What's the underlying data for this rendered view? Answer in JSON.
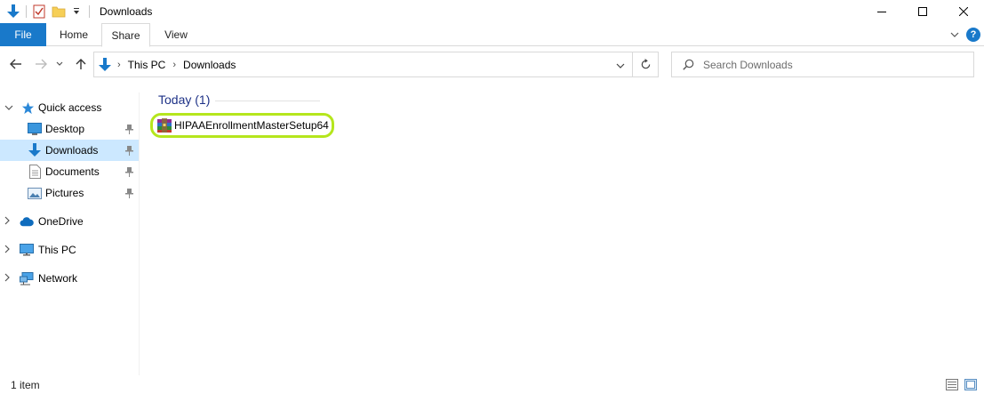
{
  "window": {
    "title": "Downloads",
    "controls": [
      "minimize",
      "maximize",
      "close"
    ]
  },
  "ribbon": {
    "tabs": [
      {
        "label": "File"
      },
      {
        "label": "Home"
      },
      {
        "label": "Share"
      },
      {
        "label": "View"
      }
    ],
    "help_label": "?"
  },
  "address": {
    "breadcrumbs": [
      "This PC",
      "Downloads"
    ],
    "separator": "›"
  },
  "search": {
    "placeholder": "Search Downloads"
  },
  "nav_pane": {
    "items": [
      {
        "label": "Quick access",
        "icon": "star-icon",
        "expander": "expanded"
      },
      {
        "label": "Desktop",
        "icon": "desktop-icon",
        "pinned": true
      },
      {
        "label": "Downloads",
        "icon": "download-arrow-icon",
        "pinned": true,
        "selected": true
      },
      {
        "label": "Documents",
        "icon": "document-icon",
        "pinned": true
      },
      {
        "label": "Pictures",
        "icon": "pictures-icon",
        "pinned": true
      },
      {
        "label": "OneDrive",
        "icon": "cloud-icon",
        "expander": "collapsed"
      },
      {
        "label": "This PC",
        "icon": "computer-icon",
        "expander": "collapsed"
      },
      {
        "label": "Network",
        "icon": "network-icon",
        "expander": "collapsed"
      }
    ]
  },
  "content": {
    "group_header": "Today (1)",
    "files": [
      {
        "name": "HIPAAEnrollmentMasterSetup64",
        "icon": "winrar-archive-icon",
        "highlight_color": "#b5e61d"
      }
    ]
  },
  "status": {
    "item_count": "1 item"
  },
  "colors": {
    "accent": "#1979ca",
    "selection": "#cce8ff",
    "group_header": "#1e3287"
  }
}
